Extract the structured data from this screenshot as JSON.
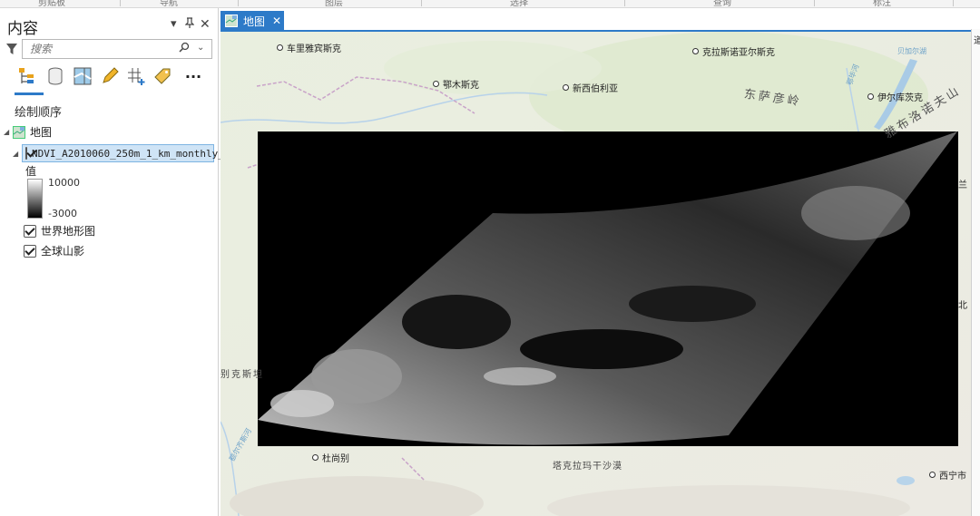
{
  "ribbon": {
    "labels": [
      "剪贴板",
      "导航",
      "图层",
      "选择",
      "查询",
      "标注"
    ]
  },
  "contents_pane": {
    "title": "内容",
    "search_placeholder": "搜索",
    "section_label": "绘制顺序",
    "map_name": "地图",
    "layers": [
      {
        "name": "NDVI_A2010060_250m_1_km_monthly_…",
        "checked": true,
        "selected": true
      },
      {
        "name": "世界地形图",
        "checked": true
      },
      {
        "name": "全球山影",
        "checked": true
      }
    ],
    "legend": {
      "title": "值",
      "high": "10000",
      "low": "-3000"
    },
    "tools": [
      "list-by-drawing-order-icon",
      "list-by-data-source-icon",
      "list-by-selection-icon",
      "list-by-editing-icon",
      "list-by-snapping-icon",
      "list-by-labeling-icon",
      "more-icon"
    ]
  },
  "map_view": {
    "tab_label": "地图",
    "cities": [
      "车里雅宾斯克",
      "克拉斯诺亚尔斯克",
      "鄂木斯克",
      "新西伯利亚",
      "伊尔库茨克",
      "杜尚别",
      "西宁市"
    ],
    "regions": [
      "东萨彦岭",
      "雅布洛诺夫山",
      "塔克拉玛干沙漠",
      "别克斯坦"
    ],
    "lake_labels": [
      "贝加尔湖",
      "鄂毕河",
      "额尔齐斯河"
    ],
    "edge_labels": [
      "兰",
      "北"
    ],
    "right_panel_char": "道"
  },
  "colors": {
    "accent": "#2d7ac8",
    "raster_bg": "#000000"
  }
}
